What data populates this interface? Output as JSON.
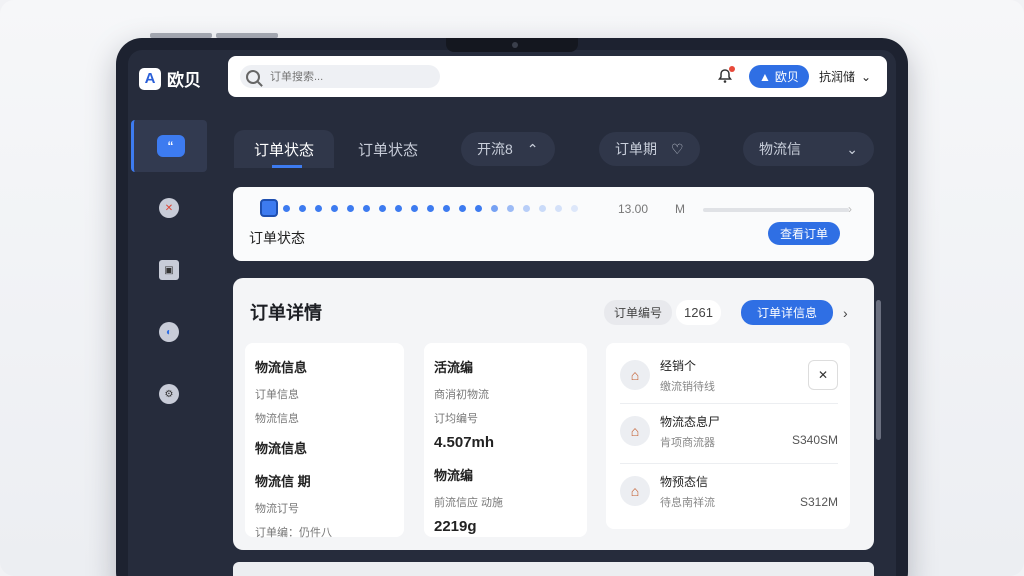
{
  "app": {
    "logo_mark": "A",
    "name": "欧贝"
  },
  "search": {
    "placeholder": "订单搜索..."
  },
  "topbar": {
    "pill_label": "欧贝",
    "user_label": "抗润储"
  },
  "tabs": [
    {
      "label": "订单状态",
      "active": true
    },
    {
      "label": "订单状态",
      "active": false
    }
  ],
  "chips": [
    {
      "label": "开流8"
    },
    {
      "label": "订单期"
    },
    {
      "label": "物流信"
    }
  ],
  "progress": {
    "time": "13.00",
    "unit": "M",
    "label": "订单状态",
    "button": "查看订单"
  },
  "detail": {
    "title": "订单详情",
    "order_no_label": "订单编号",
    "order_no_value": "1261",
    "order_button": "订单详信息",
    "cards": [
      {
        "heading": "物流信息",
        "lines": [
          "订单信息",
          "物流信息"
        ],
        "sub_heading": "物流信息",
        "heading2": "物流信   期",
        "lines2": [
          "物流订号",
          "订单编：仍件八"
        ]
      },
      {
        "heading": "活流编",
        "lines": [
          "商消初物流",
          "订均编号"
        ],
        "number": "4.507mh",
        "heading2": "物流编",
        "lines2": [
          "前流信应  动施"
        ],
        "number2": "2219g"
      }
    ],
    "list": [
      {
        "title": "经销个",
        "subtitle": "缴流销待线",
        "value": ""
      },
      {
        "title": "物流态息尸",
        "subtitle": "肯项商流器",
        "value": "S340SM"
      },
      {
        "title": "物预态信",
        "subtitle": "待息南祥流",
        "value": "S312M"
      }
    ]
  },
  "colors": {
    "accent": "#2f6fe4",
    "frame": "#1d2230",
    "screen": "#262c3c"
  }
}
